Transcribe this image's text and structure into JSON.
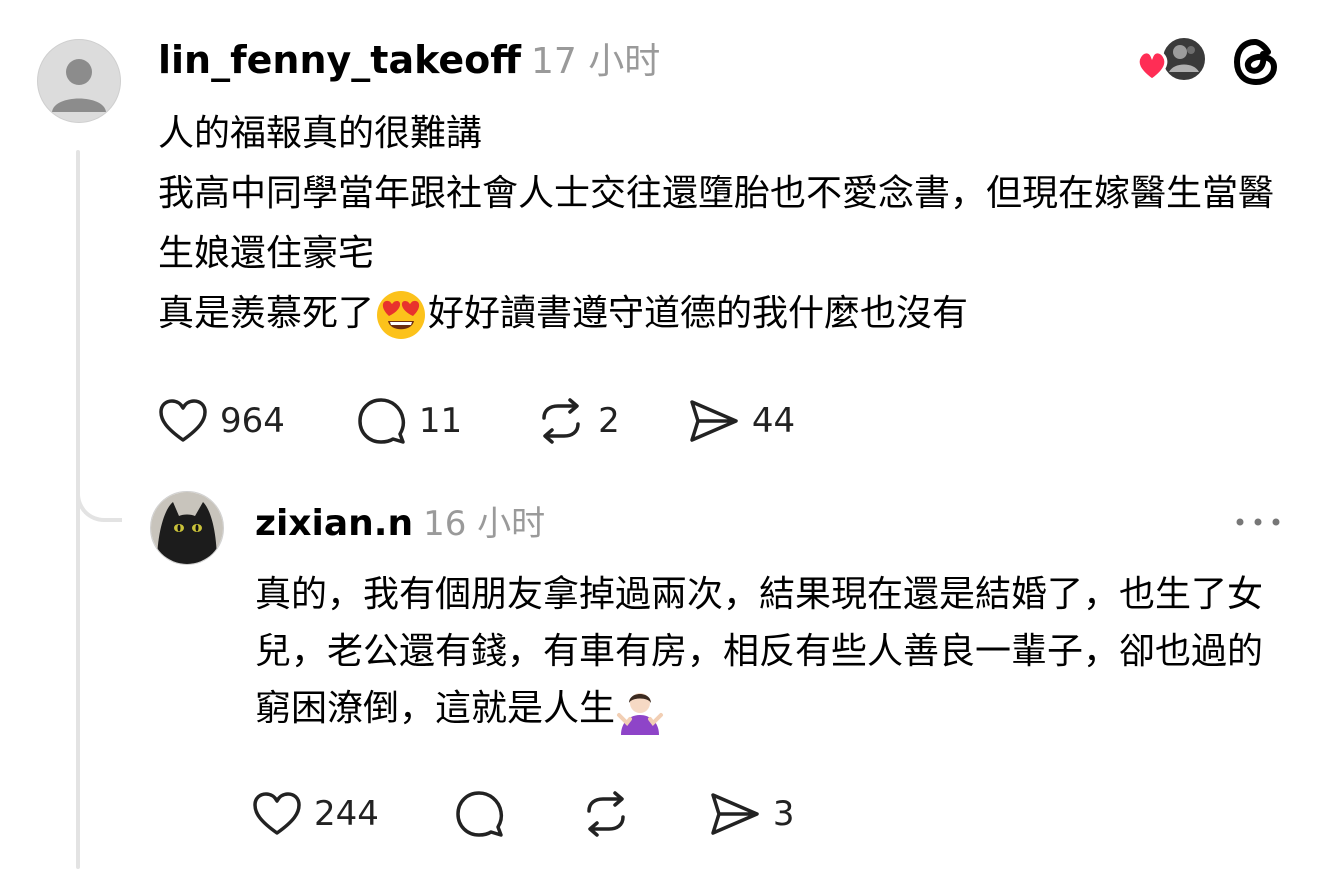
{
  "post": {
    "username": "lin_fenny_takeoff",
    "time": "17 小时",
    "lines": [
      "人的福報真的很難講",
      "我高中同學當年跟社會人士交往還墮胎也不愛念書，但現在嫁醫生當醫生娘還住豪宅"
    ],
    "last_line_before": "真是羨慕死了",
    "last_line_emoji": "heart-eyes-emoji",
    "last_line_after": "好好讀書遵守道德的我什麼也沒有",
    "likes": "964",
    "comments": "11",
    "reposts": "2",
    "shares": "44"
  },
  "reply": {
    "username": "zixian.n",
    "time": "16 小时",
    "text": "真的，我有個朋友拿掉過兩次，結果現在還是結婚了，也生了女兒，老公還有錢，有車有房，相反有些人善良一輩子，卻也過的窮困潦倒，這就是人生",
    "trailing_emoji": "shrug-emoji",
    "likes": "244",
    "comments": "",
    "reposts": "",
    "shares": "3"
  },
  "colors": {
    "like_heart": "#ff2d55",
    "muted_text": "#9a9a9a",
    "thread_line": "#e3e3e3"
  }
}
